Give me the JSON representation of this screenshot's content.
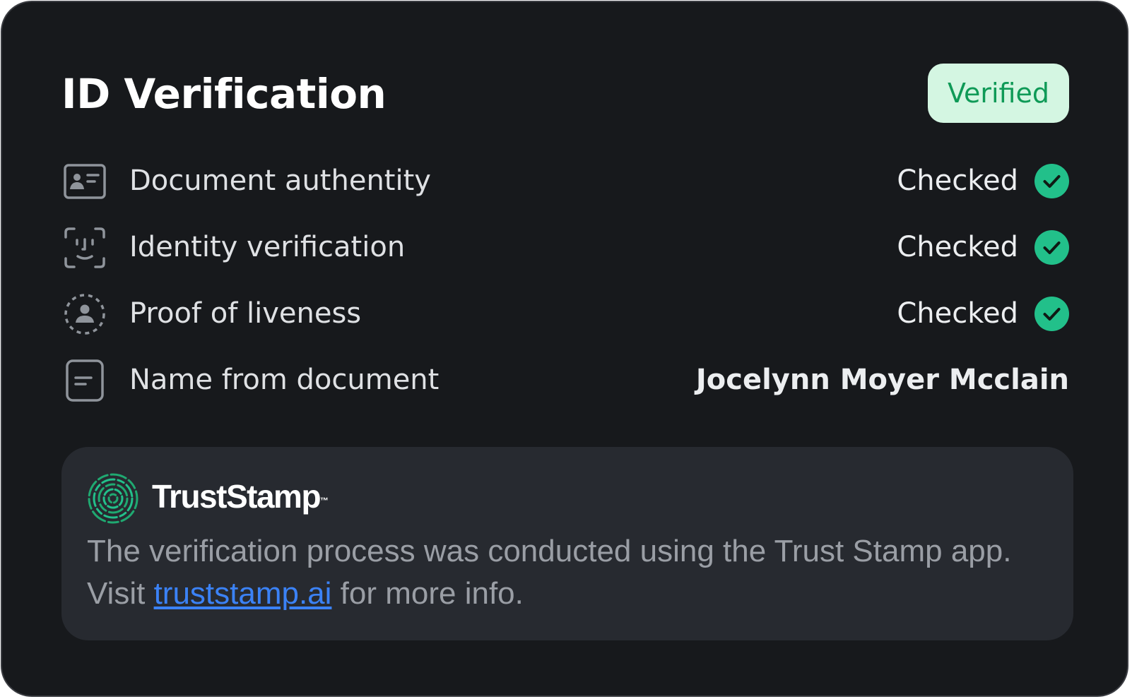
{
  "card": {
    "title": "ID Verification",
    "status_badge": "Verified"
  },
  "checks": [
    {
      "label": "Document authentity",
      "status": "Checked",
      "icon": "id-card-icon"
    },
    {
      "label": "Identity verification",
      "status": "Checked",
      "icon": "face-scan-icon"
    },
    {
      "label": "Proof of liveness",
      "status": "Checked",
      "icon": "liveness-user-icon"
    }
  ],
  "name_row": {
    "label": "Name from document",
    "value": "Jocelynn Moyer Mcclain",
    "icon": "document-lines-icon"
  },
  "provider": {
    "name": "TrustStamp",
    "trademark": "™",
    "logo_icon": "fingerprint-logo-icon",
    "text_before_link": "The verification process was conducted using the Trust Stamp app. Visit ",
    "link_text": "truststamp.ai",
    "text_after_link": " for more info."
  },
  "colors": {
    "background": "#17191c",
    "panel": "#272a30",
    "accent_green": "#22c08a",
    "badge_bg": "#d4f6e2",
    "badge_text": "#0f9a57",
    "link": "#3b82f6"
  }
}
